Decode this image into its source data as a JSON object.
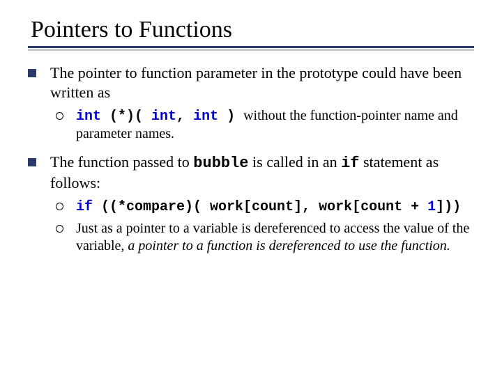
{
  "title": "Pointers to Functions",
  "b1_text": "The pointer to function parameter in the prototype could have been written as",
  "s1a_kw1": "int",
  "s1a_p1": " (*)( ",
  "s1a_kw2": "int",
  "s1a_c1": ", ",
  "s1a_kw3": "int",
  "s1a_p2": " ) ",
  "s1a_tail": "without the function-pointer name and parameter names.",
  "b2_pre": "The function passed to ",
  "b2_code1": "bubble",
  "b2_mid": " is called in an ",
  "b2_code2": "if",
  "b2_post": " statement as follows:",
  "s2a_kw_if": "if",
  "s2a_seg1": " ((*compare)( work[count], work[count + ",
  "s2a_num": "1",
  "s2a_seg2": "]))",
  "s2b_pre": "Just as a pointer to a variable is dereferenced to access the value of the variable, ",
  "s2b_em": "a pointer to a function is dereferenced to use the function.",
  "chart_data": null
}
